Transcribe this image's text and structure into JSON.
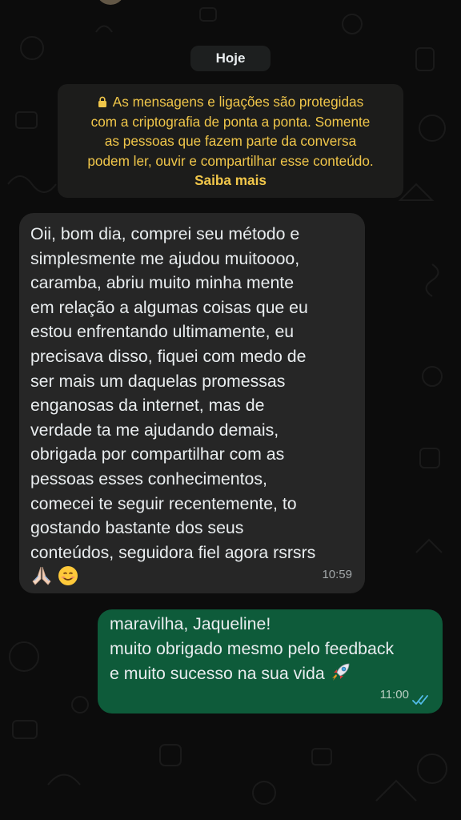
{
  "chat": {
    "date_label": "Hoje",
    "encryption": {
      "lines": [
        "As mensagens e ligações são protegidas",
        "com a criptografia de ponta a ponta. Somente",
        "as pessoas que fazem parte da conversa",
        "podem ler, ouvir e compartilhar esse conteúdo."
      ],
      "learn_more": "Saiba mais",
      "icon": "lock-icon"
    },
    "messages": [
      {
        "direction": "incoming",
        "lines": [
          "Oii, bom dia, comprei seu método e",
          "simplesmente me ajudou muitoooo,",
          "caramba, abriu muito minha mente",
          "em relação a algumas coisas que eu",
          "estou enfrentando ultimamente, eu",
          "precisava disso, fiquei com medo de",
          "ser mais um daquelas promessas",
          "enganosas da internet, mas de",
          "verdade ta me ajudando demais,",
          "obrigada por compartilhar com as",
          "pessoas esses conhecimentos,",
          "comecei te seguir recentemente, to",
          "gostando bastante dos seus",
          "conteúdos, seguidora fiel agora rsrsrs"
        ],
        "emojis": [
          "🙏🏻",
          "😊"
        ],
        "time": "10:59"
      },
      {
        "direction": "outgoing",
        "lines": [
          "maravilha, Jaqueline!",
          "muito obrigado mesmo pelo feedback",
          "e muito sucesso na sua vida"
        ],
        "emoji": "🚀",
        "time": "11:00",
        "status": "read",
        "status_icon": "double-check-icon"
      }
    ]
  },
  "colors": {
    "background": "#0c0c0c",
    "incoming_bubble": "#262626",
    "outgoing_bubble": "#0e5b3a",
    "notice_text": "#f0c64a",
    "read_ticks": "#53bdeb"
  }
}
